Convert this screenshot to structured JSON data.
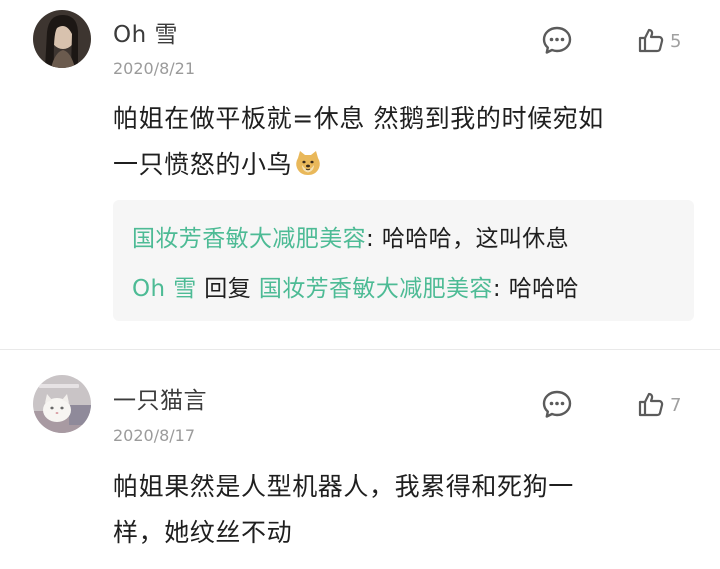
{
  "colors": {
    "accent_green": "#4dbb95",
    "text": "#1f1f1f",
    "muted": "#9b9b9b",
    "reply_box_bg": "#f6f6f6"
  },
  "comments": [
    {
      "username": "Oh 雪",
      "date": "2020/8/21",
      "like_count": "5",
      "avatar_icon": "avatar-dark-photo",
      "body_lines": [
        "帕姐在做平板就=休息  然鹅到我的时候宛如",
        "一只愤怒的小鸟"
      ],
      "emoji_icon": "doge-emoji-icon",
      "replies": [
        {
          "author": "国妆芳香敏大减肥美容",
          "separator": ": ",
          "text": "哈哈哈，这叫休息"
        },
        {
          "author": "Oh 雪",
          "reply_word": " 回复 ",
          "target": "国妆芳香敏大减肥美容",
          "separator": ": ",
          "text": "哈哈哈"
        }
      ]
    },
    {
      "username": "一只猫言",
      "date": "2020/8/17",
      "like_count": "7",
      "avatar_icon": "avatar-white-cat-photo",
      "body_lines": [
        "帕姐果然是人型机器人，我累得和死狗一",
        "样，她纹丝不动"
      ]
    }
  ]
}
